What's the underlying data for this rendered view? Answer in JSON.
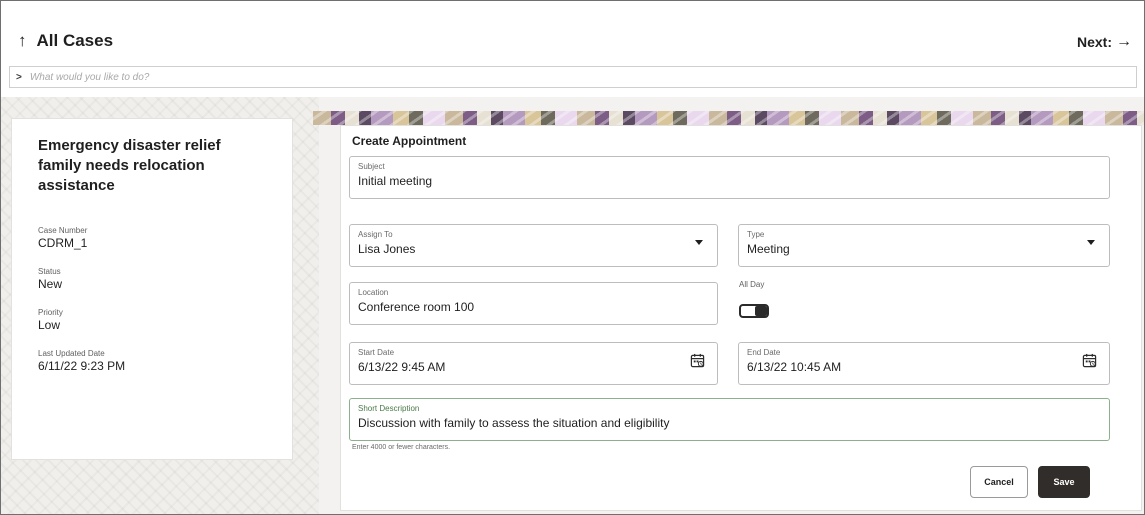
{
  "header": {
    "back_label": "All Cases",
    "next_label": "Next:"
  },
  "command_bar": {
    "placeholder": "What would you like to do?"
  },
  "case": {
    "title": "Emergency disaster relief family needs relocation assistance",
    "fields": [
      {
        "label": "Case Number",
        "value": "CDRM_1"
      },
      {
        "label": "Status",
        "value": "New"
      },
      {
        "label": "Priority",
        "value": "Low"
      },
      {
        "label": "Last Updated Date",
        "value": "6/11/22 9:23 PM"
      }
    ]
  },
  "form": {
    "title": "Create Appointment",
    "subject": {
      "label": "Subject",
      "value": "Initial meeting"
    },
    "assign_to": {
      "label": "Assign To",
      "value": "Lisa Jones"
    },
    "type": {
      "label": "Type",
      "value": "Meeting"
    },
    "location": {
      "label": "Location",
      "value": "Conference room 100"
    },
    "all_day": {
      "label": "All Day",
      "checked": false
    },
    "start_date": {
      "label": "Start Date",
      "value": "6/13/22 9:45 AM"
    },
    "end_date": {
      "label": "End Date",
      "value": "6/13/22 10:45 AM"
    },
    "short_description": {
      "label": "Short Description",
      "value": "Discussion with family to assess the situation and eligibility"
    },
    "helper_text": "Enter 4000 or fewer characters.",
    "cancel_label": "Cancel",
    "save_label": "Save"
  },
  "icons": {
    "back": "up-arrow-icon",
    "next": "right-arrow-icon",
    "command": "chevron-right-icon",
    "dropdown": "caret-down-icon",
    "calendar": "calendar-icon"
  },
  "colors": {
    "save_button": "#312d2a",
    "active_field_border": "#8cb08c",
    "page_background": "#f3f2f0"
  }
}
